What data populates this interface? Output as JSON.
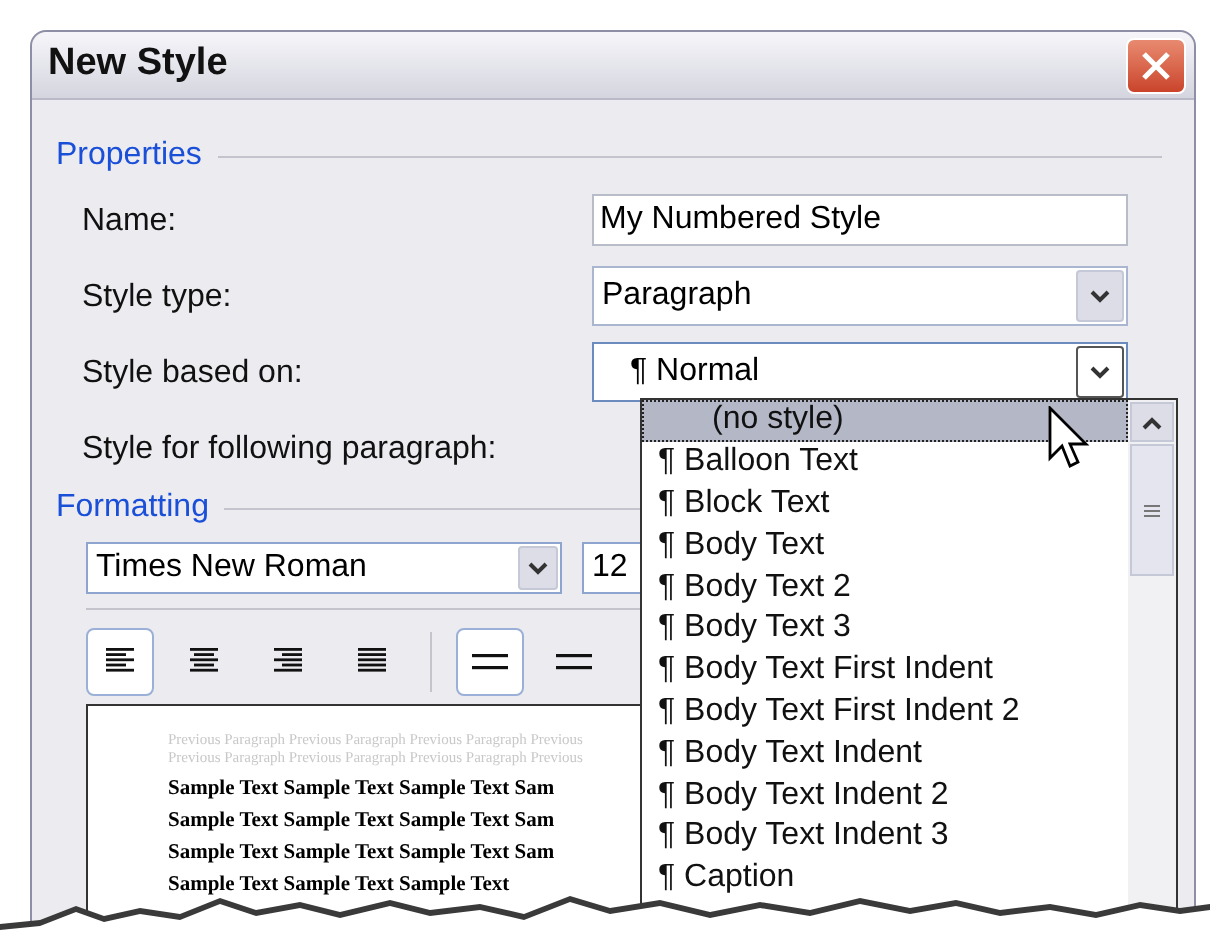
{
  "window": {
    "title": "New Style"
  },
  "properties": {
    "heading": "Properties",
    "fields": [
      {
        "label": "Name:",
        "kind": "text",
        "value": "My Numbered Style"
      },
      {
        "label": "Style type:",
        "kind": "combo",
        "value": "Paragraph"
      },
      {
        "label": "Style based on:",
        "kind": "combo",
        "value": "¶ Normal",
        "expanded": true
      },
      {
        "label": "Style for following paragraph:",
        "kind": "covered"
      }
    ]
  },
  "dropdown": {
    "items": [
      {
        "label": "(no style)",
        "selected": true
      },
      {
        "label": "¶ Balloon Text",
        "selected": false
      },
      {
        "label": "¶ Block Text",
        "selected": false
      },
      {
        "label": "¶ Body Text",
        "selected": false
      },
      {
        "label": "¶ Body Text 2",
        "selected": false
      },
      {
        "label": "¶ Body Text 3",
        "selected": false
      },
      {
        "label": "¶ Body Text First Indent",
        "selected": false
      },
      {
        "label": "¶ Body Text First Indent 2",
        "selected": false
      },
      {
        "label": "¶ Body Text Indent",
        "selected": false
      },
      {
        "label": "¶ Body Text Indent 2",
        "selected": false
      },
      {
        "label": "¶ Body Text Indent 3",
        "selected": false
      },
      {
        "label": "¶ Caption",
        "selected": false
      }
    ]
  },
  "formatting": {
    "heading": "Formatting",
    "font": "Times New Roman",
    "size": "12",
    "alignment": [
      {
        "kind": "left",
        "selected": true
      },
      {
        "kind": "center",
        "selected": false
      },
      {
        "kind": "right",
        "selected": false
      },
      {
        "kind": "justify",
        "selected": false
      }
    ],
    "spacing": [
      {
        "kind": "single",
        "selected": true
      },
      {
        "kind": "single",
        "selected": false
      }
    ]
  },
  "preview": {
    "previous": [
      "Previous Paragraph Previous Paragraph Previous Paragraph Previous",
      "Previous Paragraph Previous Paragraph Previous Paragraph Previous"
    ],
    "sample": [
      "Sample Text Sample Text Sample Text Sam",
      "Sample Text Sample Text Sample Text Sam",
      "Sample Text Sample Text Sample Text Sam",
      "Sample Text Sample Text Sample Text"
    ]
  }
}
